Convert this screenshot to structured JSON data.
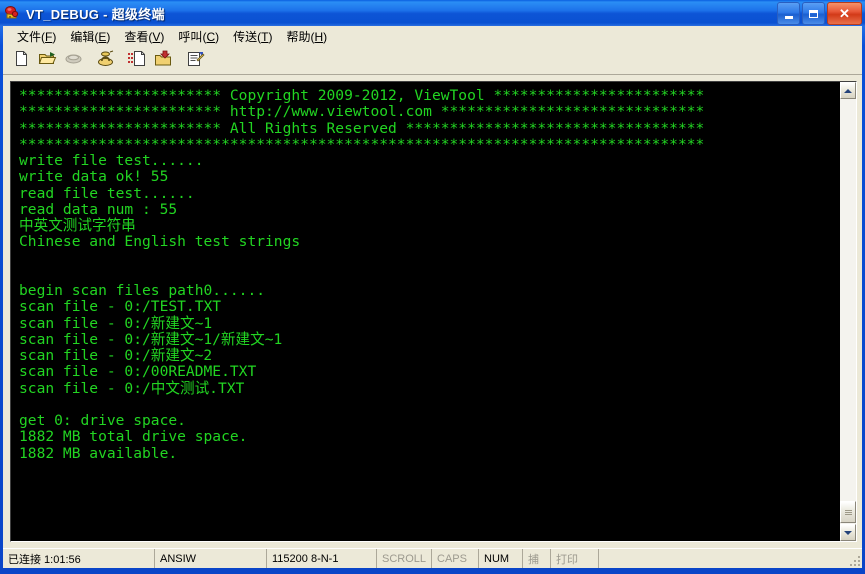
{
  "window": {
    "title": "VT_DEBUG - 超级终端",
    "icon": "hyperterminal-icon",
    "minimize_label": "_",
    "maximize_label": "□",
    "close_label": "✕"
  },
  "menu": {
    "items": [
      {
        "name": "file",
        "text": "文件",
        "accel": "F"
      },
      {
        "name": "edit",
        "text": "编辑",
        "accel": "E"
      },
      {
        "name": "view",
        "text": "查看",
        "accel": "V"
      },
      {
        "name": "call",
        "text": "呼叫",
        "accel": "C"
      },
      {
        "name": "transfer",
        "text": "传送",
        "accel": "T"
      },
      {
        "name": "help",
        "text": "帮助",
        "accel": "H"
      }
    ]
  },
  "toolbar": {
    "buttons": [
      {
        "name": "new-connection-icon",
        "title": "新建连接"
      },
      {
        "name": "open-folder-icon",
        "title": "打开"
      },
      {
        "name": "disconnect-phone-icon",
        "title": "挂断"
      },
      {
        "name": "call-phone-icon",
        "title": "呼叫"
      },
      {
        "name": "send-file-icon",
        "title": "发送"
      },
      {
        "name": "receive-file-icon",
        "title": "接收"
      },
      {
        "name": "properties-icon",
        "title": "属性"
      }
    ]
  },
  "terminal": {
    "foreground": "#22d522",
    "background": "#000000",
    "lines": [
      "*********************** Copyright 2009-2012, ViewTool ************************",
      "*********************** http://www.viewtool.com ******************************",
      "*********************** All Rights Reserved **********************************",
      "******************************************************************************",
      "write file test......",
      "write data ok! 55",
      "read file test......",
      "read data num : 55",
      "中英文测试字符串",
      "Chinese and English test strings",
      "",
      "",
      "begin scan files path0......",
      "scan file - 0:/TEST.TXT",
      "scan file - 0:/新建文~1",
      "scan file - 0:/新建文~1/新建文~1",
      "scan file - 0:/新建文~2",
      "scan file - 0:/00README.TXT",
      "scan file - 0:/中文测试.TXT",
      "",
      "get 0: drive space.",
      "1882 MB total drive space.",
      "1882 MB available."
    ]
  },
  "scrollbar": {
    "up_arrow": "scroll-up",
    "down_arrow": "scroll-down",
    "thumb": "scroll-thumb"
  },
  "statusbar": {
    "connected": "已连接 1:01:56",
    "emulation": "ANSIW",
    "line_settings": "115200 8-N-1",
    "scroll": "SCROLL",
    "caps": "CAPS",
    "num": "NUM",
    "capture": "捕",
    "print": "打印"
  }
}
